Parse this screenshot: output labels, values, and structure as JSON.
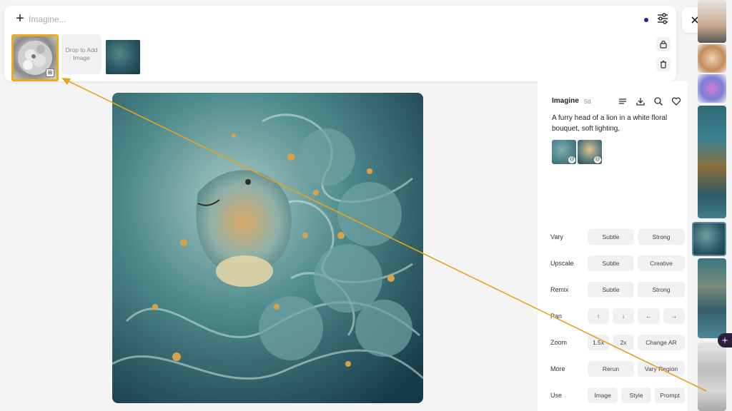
{
  "prompt_bar": {
    "placeholder": "Imagine...",
    "plus_icon": "plus-icon",
    "settings_icon": "sliders-icon",
    "status_dot_color": "#2a1f8f",
    "drop_zone_text": "Drop to Add Image",
    "lock_icon": "lock-icon",
    "trash_icon": "trash-icon"
  },
  "close_icon": "close-icon",
  "info": {
    "title": "Imagine",
    "age": "5d",
    "description": "A furry head of a lion in a white floral bouquet, soft lighting,",
    "icons": [
      "list-icon",
      "download-icon",
      "search-icon",
      "heart-icon"
    ]
  },
  "actions": [
    {
      "label": "Vary",
      "buttons": [
        "Subtle",
        "Strong"
      ]
    },
    {
      "label": "Upscale",
      "buttons": [
        "Subtle",
        "Creative"
      ]
    },
    {
      "label": "Remix",
      "buttons": [
        "Subtle",
        "Strong"
      ]
    },
    {
      "label": "Pan",
      "buttons": [
        "↑",
        "↓",
        "←",
        "→"
      ]
    },
    {
      "label": "Zoom",
      "buttons": [
        "1.5x",
        "2x",
        "Change AR"
      ]
    },
    {
      "label": "More",
      "buttons": [
        "Rerun",
        "Vary Region"
      ]
    },
    {
      "label": "Use",
      "buttons": [
        "Image",
        "Style",
        "Prompt"
      ]
    }
  ],
  "colors": {
    "accent_orange": "#f0a81b",
    "panel_bg": "#ffffff",
    "page_bg": "#f4f4f5"
  }
}
